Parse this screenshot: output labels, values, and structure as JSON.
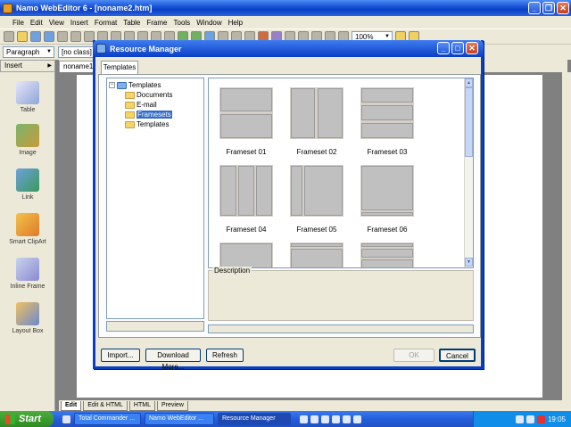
{
  "app": {
    "title": "Namo WebEditor 6 - [noname2.htm]",
    "menu": [
      "File",
      "Edit",
      "View",
      "Insert",
      "Format",
      "Table",
      "Frame",
      "Tools",
      "Window",
      "Help"
    ],
    "paragraph_style": "Paragraph",
    "class_value": "[no class]",
    "zoom_value": "100%",
    "insert_label": "Insert",
    "doc_tab": "noname1.",
    "side_items": [
      {
        "label": "Table",
        "icon": "table-icon"
      },
      {
        "label": "Image",
        "icon": "image-icon"
      },
      {
        "label": "Link",
        "icon": "link-icon"
      },
      {
        "label": "Smart ClipArt",
        "icon": "clipart-icon"
      },
      {
        "label": "Inline Frame",
        "icon": "inline-frame-icon"
      },
      {
        "label": "Layout Box",
        "icon": "layout-box-icon"
      }
    ],
    "view_tabs": [
      "Edit",
      "Edit & HTML",
      "HTML",
      "Preview"
    ]
  },
  "dialog": {
    "title": "Resource Manager",
    "tab": "Templates",
    "tree": {
      "root": "Templates",
      "children": [
        "Documents",
        "E-mail",
        "Framesets",
        "Templates"
      ],
      "selected": "Framesets"
    },
    "thumbnails": [
      "Frameset 01",
      "Frameset 02",
      "Frameset 03",
      "Frameset 04",
      "Frameset 05",
      "Frameset 06"
    ],
    "description_label": "Description",
    "buttons": {
      "import": "Import...",
      "download": "Download More...",
      "refresh": "Refresh",
      "ok": "OK",
      "cancel": "Cancel"
    }
  },
  "taskbar": {
    "start": "Start",
    "items": [
      "Total Commander ...",
      "Namo WebEditor ...",
      "Resource Manager"
    ],
    "active": "Resource Manager",
    "clock": "19:05"
  }
}
